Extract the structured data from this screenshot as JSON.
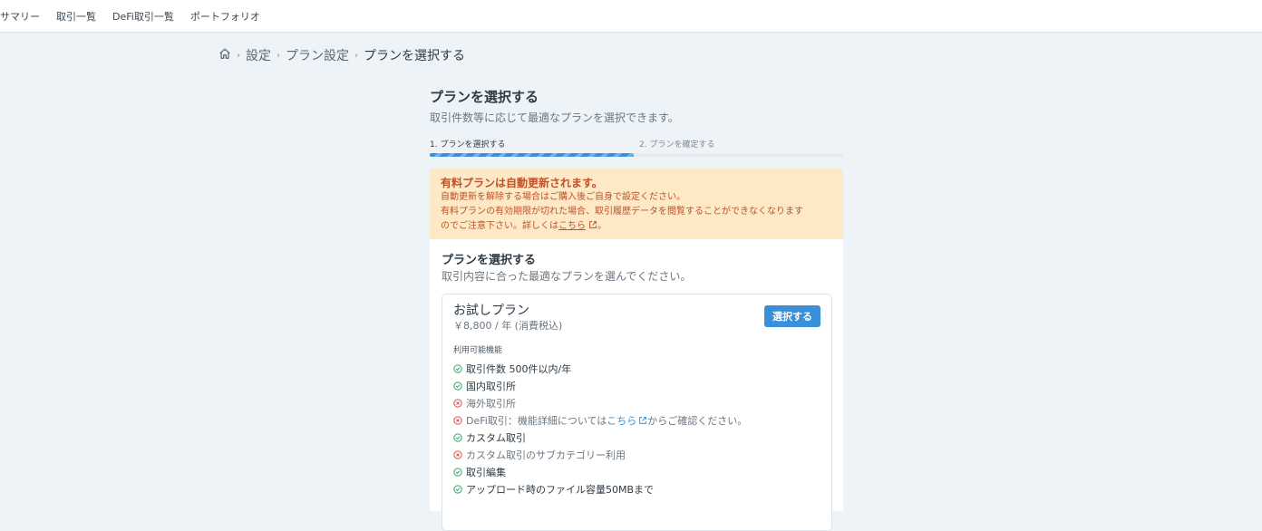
{
  "nav": {
    "items": [
      {
        "label": "サマリー"
      },
      {
        "label": "取引一覧"
      },
      {
        "label": "DeFi取引一覧"
      },
      {
        "label": "ポートフォリオ"
      }
    ]
  },
  "breadcrumb": {
    "items": [
      "設定",
      "プラン設定"
    ],
    "current": "プランを選択する"
  },
  "page": {
    "title": "プランを選択する",
    "subtitle": "取引件数等に応じて最適なプランを選択できます。"
  },
  "steps": {
    "step1": "1. プランを選択する",
    "step2": "2. プランを確定する",
    "progress_fraction": 0.5
  },
  "alert": {
    "title": "有料プランは自動更新されます。",
    "line1": "自動更新を解除する場合はご購入後ご自身で設定ください。",
    "line2": "有料プランの有効期限が切れた場合、取引履歴データを閲覧することができなくなります",
    "line3_prefix": "のでご注意下さい。詳しくは",
    "link": "こちら",
    "line3_suffix": "。"
  },
  "panel": {
    "title": "プランを選択する",
    "subtitle": "取引内容に合った最適なプランを選んでください。"
  },
  "plan": {
    "name": "お試しプラン",
    "price": "￥8,800 / 年 (消費税込)",
    "button": "選択する",
    "features_label": "利用可能機能",
    "features": [
      {
        "text": "取引件数 500件以内/年",
        "available": true
      },
      {
        "text": "国内取引所",
        "available": true
      },
      {
        "text": "海外取引所",
        "available": false
      },
      {
        "text": "DeFi取引：機能詳細については",
        "link": "こちら",
        "suffix": "からご確認ください。",
        "available": false
      },
      {
        "text": "カスタム取引",
        "available": true
      },
      {
        "text": "カスタム取引のサブカテゴリー利用",
        "available": false
      },
      {
        "text": "取引編集",
        "available": true
      },
      {
        "text": "アップロード時のファイル容量50MBまで",
        "available": true
      }
    ]
  },
  "colors": {
    "primary": "#3a8fd9",
    "check_green": "#2fa86a",
    "cross_red": "#d9534f",
    "alert_bg": "#fde9c5",
    "alert_text": "#c0522a",
    "page_bg": "#eef3f8"
  }
}
